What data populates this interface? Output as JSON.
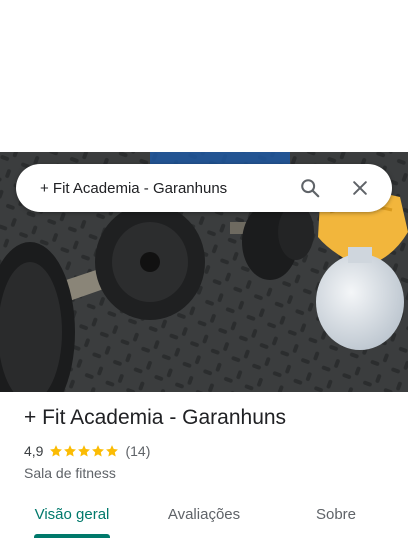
{
  "search": {
    "query": "+ Fit Academia - Garanhuns",
    "search_icon": "search-icon",
    "close_icon": "close-icon"
  },
  "place": {
    "title": "+ Fit Academia - Garanhuns",
    "rating": "4,9",
    "rating_fraction": 0.98,
    "stars_icon": "star-icon",
    "review_count": "(14)",
    "category": "Sala de fitness"
  },
  "tabs": [
    {
      "label": "Visão geral",
      "active": true
    },
    {
      "label": "Avaliações",
      "active": false
    },
    {
      "label": "Sobre",
      "active": false
    }
  ],
  "colors": {
    "accent": "#00796b",
    "star": "#fbbc04"
  }
}
